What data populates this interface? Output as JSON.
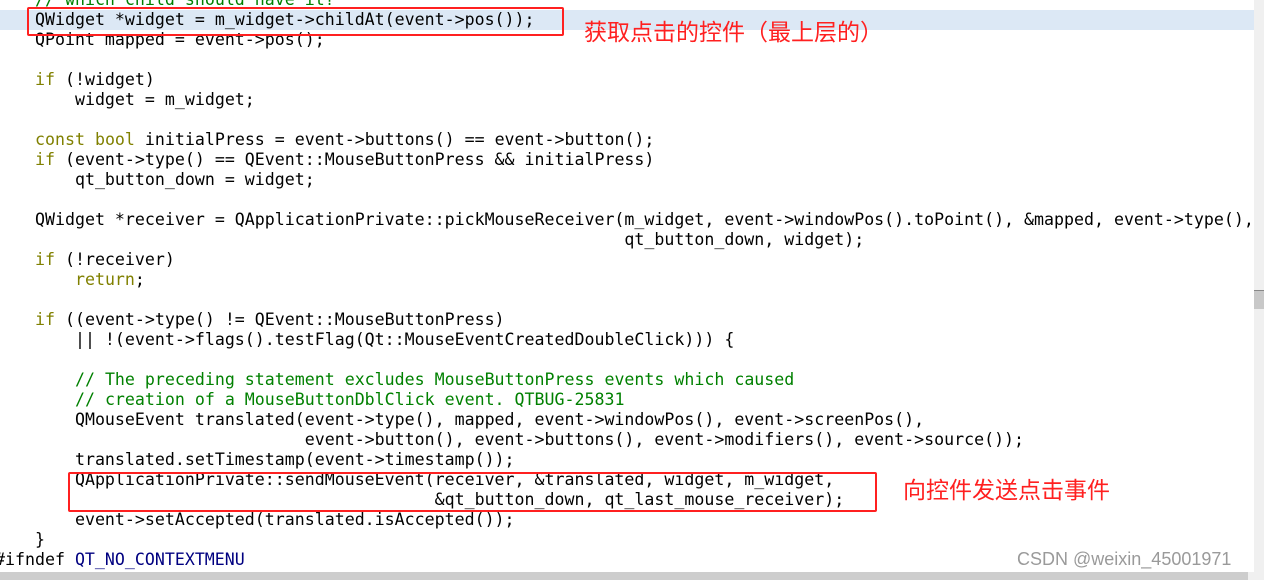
{
  "editor": {
    "current_line": 1,
    "lines": [
      [
        [
          "cm",
          "// which child should have it?"
        ]
      ],
      [
        [
          "tx",
          "QWidget *widget = m_widget->childAt(event->pos());"
        ]
      ],
      [
        [
          "tx",
          "QPoint mapped = event->pos();"
        ]
      ],
      [],
      [
        [
          "kw",
          "if"
        ],
        [
          "tx",
          " (!widget)"
        ]
      ],
      [
        [
          "tx",
          "    widget = m_widget;"
        ]
      ],
      [],
      [
        [
          "kw",
          "const"
        ],
        [
          "tx",
          " "
        ],
        [
          "kw",
          "bool"
        ],
        [
          "tx",
          " initialPress = event->buttons() == event->button();"
        ]
      ],
      [
        [
          "kw",
          "if"
        ],
        [
          "tx",
          " (event->type() == QEvent::MouseButtonPress && initialPress)"
        ]
      ],
      [
        [
          "tx",
          "    qt_button_down = widget;"
        ]
      ],
      [],
      [
        [
          "tx",
          "QWidget *receiver = QApplicationPrivate::pickMouseReceiver(m_widget, event->windowPos().toPoint(), &mapped, event->type(),"
        ]
      ],
      [
        [
          "tx",
          "                                                           qt_button_down, widget);"
        ]
      ],
      [
        [
          "kw",
          "if"
        ],
        [
          "tx",
          " (!receiver)"
        ]
      ],
      [
        [
          "tx",
          "    "
        ],
        [
          "kw",
          "return"
        ],
        [
          "tx",
          ";"
        ]
      ],
      [],
      [
        [
          "kw",
          "if"
        ],
        [
          "tx",
          " ((event->type() != QEvent::MouseButtonPress)"
        ]
      ],
      [
        [
          "tx",
          "    || !(event->flags().testFlag(Qt::MouseEventCreatedDoubleClick))) {"
        ]
      ],
      [],
      [
        [
          "tx",
          "    "
        ],
        [
          "cm",
          "// The preceding statement excludes MouseButtonPress events which caused"
        ]
      ],
      [
        [
          "tx",
          "    "
        ],
        [
          "cm",
          "// creation of a MouseButtonDblClick event. QTBUG-25831"
        ]
      ],
      [
        [
          "tx",
          "    QMouseEvent translated(event->type(), mapped, event->windowPos(), event->screenPos(),"
        ]
      ],
      [
        [
          "tx",
          "                           event->button(), event->buttons(), event->modifiers(), event->source());"
        ]
      ],
      [
        [
          "tx",
          "    translated.setTimestamp(event->timestamp());"
        ]
      ],
      [
        [
          "tx",
          "    QApplicationPrivate::sendMouseEvent(receiver, &translated, widget, m_widget,"
        ]
      ],
      [
        [
          "tx",
          "                                        &qt_button_down, qt_last_mouse_receiver);"
        ]
      ],
      [
        [
          "tx",
          "    event->setAccepted(translated.isAccepted());"
        ]
      ],
      [
        [
          "tx",
          "}"
        ]
      ],
      [
        [
          "tx",
          "#ifndef "
        ],
        [
          "pp-t",
          "QT_NO_CONTEXTMENU"
        ]
      ]
    ]
  },
  "annotations": {
    "first": "获取点击的控件（最上层的）",
    "second": "向控件发送点击事件"
  },
  "colors": {
    "keyword": "#808000",
    "comment": "#008000",
    "annotation": "#ff2020",
    "current_line": "#dce8f5"
  },
  "watermark": "CSDN @weixin_45001971"
}
